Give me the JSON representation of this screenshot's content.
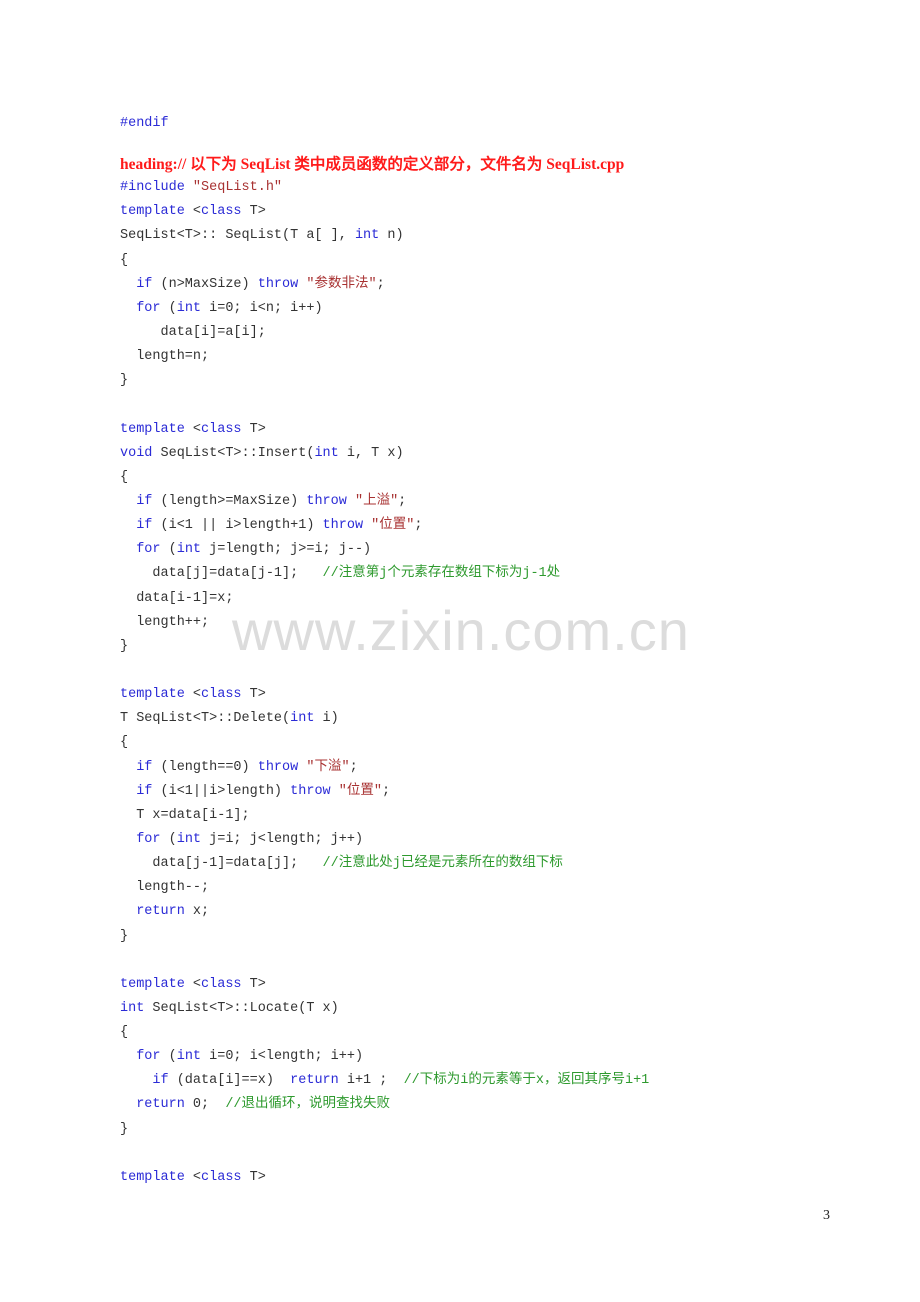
{
  "watermark": "www.zixin.com.cn",
  "page_number": "3",
  "colors": {
    "keyword": "#2b2bd6",
    "string": "#a83232",
    "comment": "#2e9a2e",
    "heading": "#ff1a1a",
    "text": "#333333"
  },
  "code_lines": [
    [
      [
        "k",
        "#endif"
      ]
    ],
    "blank-short",
    "heading:// 以下为 SeqList 类中成员函数的定义部分，文件名为 SeqList.cpp",
    [
      [
        "k",
        "#include "
      ],
      [
        "s",
        "\"SeqList.h\""
      ]
    ],
    [
      [
        "k",
        "template "
      ],
      [
        "t",
        "<"
      ],
      [
        "k",
        "class"
      ],
      [
        "t",
        " T>"
      ]
    ],
    [
      [
        "t",
        "SeqList<T>:: SeqList(T a[ ], "
      ],
      [
        "k",
        "int"
      ],
      [
        "t",
        " n)"
      ]
    ],
    [
      [
        "t",
        "{"
      ]
    ],
    [
      [
        "t",
        "  "
      ],
      [
        "k",
        "if"
      ],
      [
        "t",
        " (n>MaxSize) "
      ],
      [
        "k",
        "throw"
      ],
      [
        "t",
        " "
      ],
      [
        "s",
        "\"参数非法\""
      ],
      [
        "t",
        ";"
      ]
    ],
    [
      [
        "t",
        "  "
      ],
      [
        "k",
        "for"
      ],
      [
        "t",
        " ("
      ],
      [
        "k",
        "int"
      ],
      [
        "t",
        " i=0; i<n; i++)"
      ]
    ],
    [
      [
        "t",
        "     data[i]=a[i];"
      ]
    ],
    [
      [
        "t",
        "  length=n;"
      ]
    ],
    [
      [
        "t",
        "}"
      ]
    ],
    [],
    [
      [
        "k",
        "template "
      ],
      [
        "t",
        "<"
      ],
      [
        "k",
        "class"
      ],
      [
        "t",
        " T>"
      ]
    ],
    [
      [
        "k",
        "void"
      ],
      [
        "t",
        " SeqList<T>::Insert("
      ],
      [
        "k",
        "int"
      ],
      [
        "t",
        " i, T x)"
      ]
    ],
    [
      [
        "t",
        "{"
      ]
    ],
    [
      [
        "t",
        "  "
      ],
      [
        "k",
        "if"
      ],
      [
        "t",
        " (length>=MaxSize) "
      ],
      [
        "k",
        "throw"
      ],
      [
        "t",
        " "
      ],
      [
        "s",
        "\"上溢\""
      ],
      [
        "t",
        ";"
      ]
    ],
    [
      [
        "t",
        "  "
      ],
      [
        "k",
        "if"
      ],
      [
        "t",
        " (i<1 || i>length+1) "
      ],
      [
        "k",
        "throw"
      ],
      [
        "t",
        " "
      ],
      [
        "s",
        "\"位置\""
      ],
      [
        "t",
        ";"
      ]
    ],
    [
      [
        "t",
        "  "
      ],
      [
        "k",
        "for"
      ],
      [
        "t",
        " ("
      ],
      [
        "k",
        "int"
      ],
      [
        "t",
        " j=length; j>=i; j--)"
      ]
    ],
    [
      [
        "t",
        "    data[j]=data[j-1];   "
      ],
      [
        "c",
        "//注意第j个元素存在数组下标为j-1处"
      ]
    ],
    [
      [
        "t",
        "  data[i-1]=x;"
      ]
    ],
    [
      [
        "t",
        "  length++;"
      ]
    ],
    [
      [
        "t",
        "}"
      ]
    ],
    [],
    [
      [
        "k",
        "template "
      ],
      [
        "t",
        "<"
      ],
      [
        "k",
        "class"
      ],
      [
        "t",
        " T>"
      ]
    ],
    [
      [
        "t",
        "T SeqList<T>::Delete("
      ],
      [
        "k",
        "int"
      ],
      [
        "t",
        " i)"
      ]
    ],
    [
      [
        "t",
        "{"
      ]
    ],
    [
      [
        "t",
        "  "
      ],
      [
        "k",
        "if"
      ],
      [
        "t",
        " (length==0) "
      ],
      [
        "k",
        "throw"
      ],
      [
        "t",
        " "
      ],
      [
        "s",
        "\"下溢\""
      ],
      [
        "t",
        ";"
      ]
    ],
    [
      [
        "t",
        "  "
      ],
      [
        "k",
        "if"
      ],
      [
        "t",
        " (i<1||i>length) "
      ],
      [
        "k",
        "throw"
      ],
      [
        "t",
        " "
      ],
      [
        "s",
        "\"位置\""
      ],
      [
        "t",
        ";"
      ]
    ],
    [
      [
        "t",
        "  T x=data[i-1];"
      ]
    ],
    [
      [
        "t",
        "  "
      ],
      [
        "k",
        "for"
      ],
      [
        "t",
        " ("
      ],
      [
        "k",
        "int"
      ],
      [
        "t",
        " j=i; j<length; j++)"
      ]
    ],
    [
      [
        "t",
        "    data[j-1]=data[j];   "
      ],
      [
        "c",
        "//注意此处j已经是元素所在的数组下标"
      ]
    ],
    [
      [
        "t",
        "  length--;"
      ]
    ],
    [
      [
        "t",
        "  "
      ],
      [
        "k",
        "return"
      ],
      [
        "t",
        " x;"
      ]
    ],
    [
      [
        "t",
        "}"
      ]
    ],
    [],
    [
      [
        "k",
        "template "
      ],
      [
        "t",
        "<"
      ],
      [
        "k",
        "class"
      ],
      [
        "t",
        " T>"
      ]
    ],
    [
      [
        "k",
        "int"
      ],
      [
        "t",
        " SeqList<T>::Locate(T x)"
      ]
    ],
    [
      [
        "t",
        "{"
      ]
    ],
    [
      [
        "t",
        "  "
      ],
      [
        "k",
        "for"
      ],
      [
        "t",
        " ("
      ],
      [
        "k",
        "int"
      ],
      [
        "t",
        " i=0; i<length; i++)"
      ]
    ],
    [
      [
        "t",
        "    "
      ],
      [
        "k",
        "if"
      ],
      [
        "t",
        " (data[i]==x)  "
      ],
      [
        "k",
        "return"
      ],
      [
        "t",
        " i+1 ;  "
      ],
      [
        "c",
        "//下标为i的元素等于x，返回其序号i+1"
      ]
    ],
    [
      [
        "t",
        "  "
      ],
      [
        "k",
        "return"
      ],
      [
        "t",
        " 0;  "
      ],
      [
        "c",
        "//退出循环，说明查找失败"
      ]
    ],
    [
      [
        "t",
        "}"
      ]
    ],
    [],
    [
      [
        "k",
        "template "
      ],
      [
        "t",
        "<"
      ],
      [
        "k",
        "class"
      ],
      [
        "t",
        " T>"
      ]
    ]
  ]
}
